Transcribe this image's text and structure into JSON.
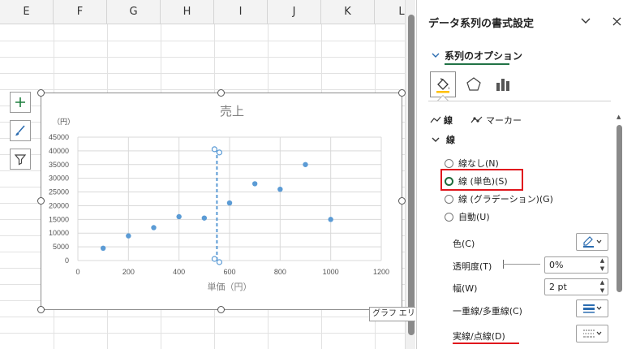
{
  "sheet": {
    "columns": [
      "E",
      "F",
      "G",
      "H",
      "I",
      "J",
      "K",
      "L"
    ]
  },
  "chart": {
    "tooltip": "グラフ エリア"
  },
  "chart_data": {
    "type": "scatter",
    "title": "売上",
    "xlabel": "単価（円）",
    "ylabel": "（円）",
    "xlim": [
      0,
      1200
    ],
    "ylim": [
      0,
      45000
    ],
    "x_ticks": [
      0,
      200,
      400,
      600,
      800,
      1000,
      1200
    ],
    "y_ticks": [
      0,
      5000,
      10000,
      15000,
      20000,
      25000,
      30000,
      35000,
      40000,
      45000
    ],
    "series": [
      {
        "x": [
          100,
          200,
          300,
          400,
          500,
          600,
          700,
          800,
          900,
          1000
        ],
        "y": [
          4500,
          9000,
          12000,
          16000,
          15500,
          21000,
          28000,
          26000,
          35000,
          15000
        ]
      }
    ],
    "selected_series": {
      "x": [
        550,
        550,
        550,
        550
      ],
      "y": [
        0,
        0,
        40000,
        40000
      ],
      "style": "dashed"
    },
    "grid": true,
    "marker_color": "#5b9bd5"
  },
  "pane": {
    "title": "データ系列の書式設定",
    "series_options_label": "系列のオプション",
    "tabs": {
      "line": "線",
      "marker": "マーカー"
    },
    "section_line": "線",
    "radio_options": [
      {
        "label": "線なし(N)",
        "checked": false
      },
      {
        "label": "線 (単色)(S)",
        "checked": true
      },
      {
        "label": "線 (グラデーション)(G)",
        "checked": false
      },
      {
        "label": "自動(U)",
        "checked": false
      }
    ],
    "color_label": "色(C)",
    "transparency_label": "透明度(T)",
    "transparency_value": "0%",
    "width_label": "幅(W)",
    "width_value": "2 pt",
    "compound_label": "一重線/多重線(C)",
    "dash_label": "実線/点線(D)",
    "accent_color": "#217346",
    "highlight_color": "#e0161d"
  }
}
